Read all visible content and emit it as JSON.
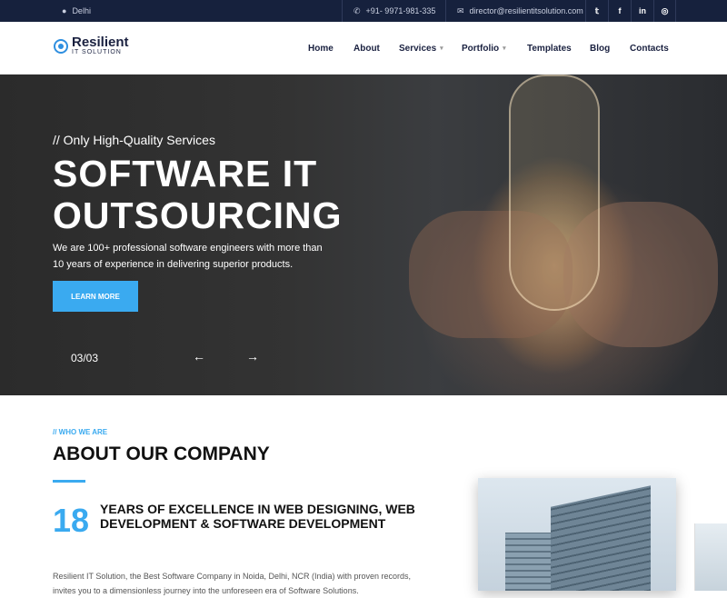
{
  "topbar": {
    "location": "Delhi",
    "phone": "+91- 9971-981-335",
    "email": "director@resilientitsolution.com",
    "social": [
      "twitter-icon",
      "facebook-icon",
      "linkedin-icon",
      "instagram-icon"
    ],
    "social_glyphs": [
      "𝕥",
      "f",
      "in",
      "◎"
    ]
  },
  "brand": {
    "name": "Resilient",
    "tagline": "IT SOLUTION"
  },
  "nav": {
    "items": [
      {
        "label": "Home"
      },
      {
        "label": "About"
      },
      {
        "label": "Services"
      },
      {
        "label": "Portfolio"
      },
      {
        "label": "Templates"
      },
      {
        "label": "Blog"
      },
      {
        "label": "Contacts"
      }
    ]
  },
  "hero": {
    "kicker": "// Only High-Quality Services",
    "title_line1": "SOFTWARE IT",
    "title_line2": "OUTSOURCING",
    "text": "We are 100+ professional software engineers with more than 10 years of experience in delivering superior products.",
    "button": "LEARN MORE",
    "slide_counter": "03/03",
    "prev": "←",
    "next": "→"
  },
  "about": {
    "kicker": "// WHO WE ARE",
    "title": "ABOUT OUR COMPANY",
    "years_number": "18",
    "years_text": "YEARS OF EXCELLENCE IN WEB DESIGNING, WEB DEVELOPMENT & SOFTWARE DEVELOPMENT",
    "paragraph": "Resilient IT Solution, the Best Software Company in Noida, Delhi, NCR (India) with proven records, invites you to a dimensionless journey into the unforeseen era of Software Solutions."
  },
  "colors": {
    "accent": "#3aaaf0",
    "dark": "#16213d"
  }
}
